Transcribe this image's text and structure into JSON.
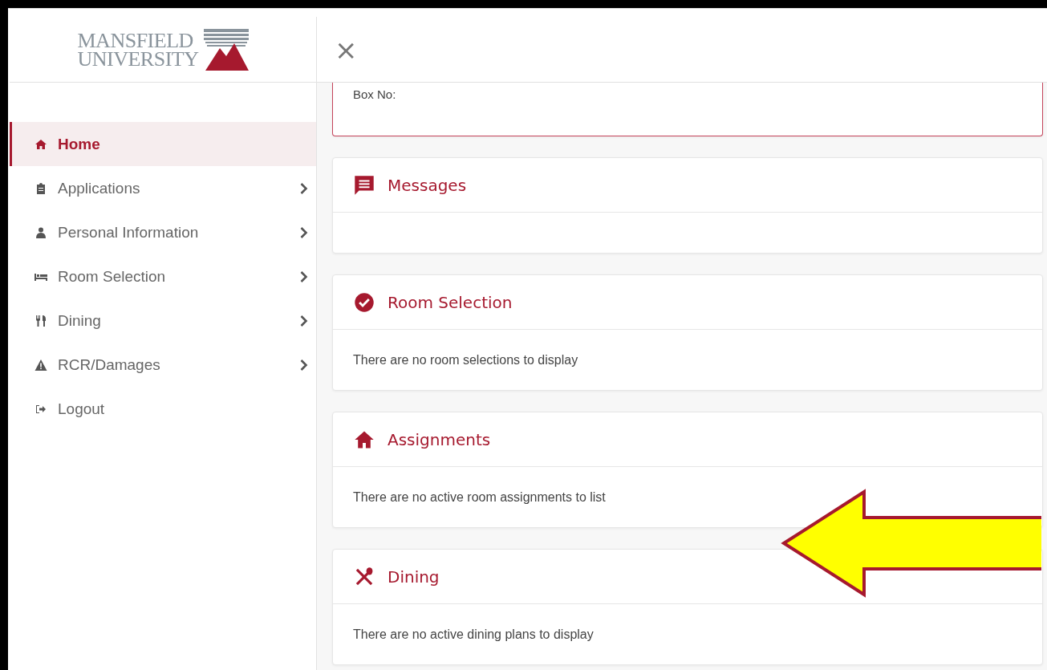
{
  "logo": {
    "line1": "MANSFIELD",
    "line2": "UNIVERSITY"
  },
  "close_button": {
    "label": "×"
  },
  "sidebar": {
    "items": [
      {
        "label": "Home",
        "selected": true,
        "submenu": false
      },
      {
        "label": "Applications",
        "selected": false,
        "submenu": true
      },
      {
        "label": "Personal Information",
        "selected": false,
        "submenu": true
      },
      {
        "label": "Room Selection",
        "selected": false,
        "submenu": true
      },
      {
        "label": "Dining",
        "selected": false,
        "submenu": true
      },
      {
        "label": "RCR/Damages",
        "selected": false,
        "submenu": true
      },
      {
        "label": "Logout",
        "selected": false,
        "submenu": false
      }
    ]
  },
  "partial_card": {
    "text": "Box No:"
  },
  "cards": [
    {
      "title": "Messages"
    },
    {
      "title": "Room Selection",
      "text": "There are no room selections to display"
    },
    {
      "title": "Assignments",
      "text": "There are no active room assignments to list"
    },
    {
      "title": "Dining",
      "text": "There are no active dining plans to display"
    }
  ]
}
